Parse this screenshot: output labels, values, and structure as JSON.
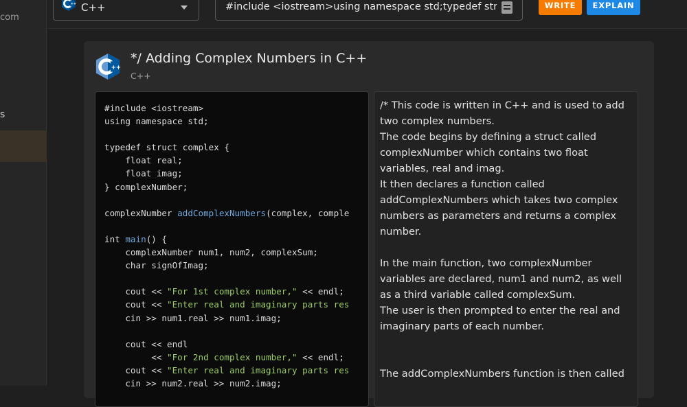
{
  "sidebar": {
    "domain_fragment": "com",
    "item_fragment": "s"
  },
  "toolbar": {
    "language": "C++",
    "code_value": "#include <iostream>using namespace std;typedef struct",
    "write_label": "WRITE",
    "explain_label": "EXPLAIN"
  },
  "card": {
    "title": "*/ Adding Complex Numbers in C++",
    "subtitle": "C++",
    "code_lines": [
      "#include <iostream>",
      "using namespace std;",
      "",
      "typedef struct complex {",
      "    float real;",
      "    float imag;",
      "} complexNumber;",
      "",
      "complexNumber addComplexNumbers(complex, comple",
      "",
      "int main() {",
      "    complexNumber num1, num2, complexSum;",
      "    char signOfImag;",
      "",
      "    cout << \"For 1st complex number,\" << endl;",
      "    cout << \"Enter real and imaginary parts res",
      "    cin >> num1.real >> num1.imag;",
      "",
      "    cout << endl",
      "         << \"For 2nd complex number,\" << endl;",
      "    cout << \"Enter real and imaginary parts res",
      "    cin >> num2.real >> num2.imag;"
    ],
    "explanation": "/* This code is written in C++ and is used to add two complex numbers.\nThe code begins by defining a struct called complexNumber which contains two float variables, real and imag.\nIt then declares a function called addComplexNumbers which takes two complex numbers as parameters and returns a complex number.\n\nIn the main function, two complexNumber variables are declared, num1 and num2, as well as a third variable called complexSum.\nThe user is then prompted to enter the real and imaginary parts of each number.\n\n\nThe addComplexNumbers function is then called"
  },
  "colors": {
    "write": "#f57c00",
    "explain": "#1e88e5",
    "function_name": "#6fa8dc",
    "string": "#9ccc65"
  },
  "icons": {
    "language": "cpp-logo-icon",
    "dropdown": "chevron-down-icon",
    "input": "document-icon"
  }
}
